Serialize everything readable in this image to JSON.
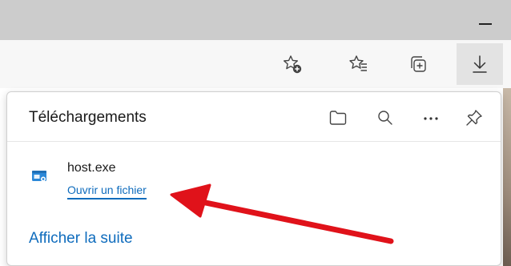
{
  "window": {
    "minimize_icon": "minimize-icon"
  },
  "toolbar": {
    "buttons": [
      {
        "name": "add-favorite",
        "icon": "star-plus-icon"
      },
      {
        "name": "favorites",
        "icon": "star-list-icon"
      },
      {
        "name": "collections",
        "icon": "collections-icon"
      },
      {
        "name": "downloads",
        "icon": "download-icon",
        "active": true
      }
    ]
  },
  "downloads_panel": {
    "title": "Téléchargements",
    "actions": [
      {
        "name": "open-folder",
        "icon": "folder-icon"
      },
      {
        "name": "search",
        "icon": "search-icon"
      },
      {
        "name": "more",
        "icon": "more-icon"
      },
      {
        "name": "pin",
        "icon": "pin-icon"
      }
    ],
    "items": [
      {
        "file_name": "host.exe",
        "action_label": "Ouvrir un fichier",
        "icon": "exe-file-icon"
      }
    ],
    "show_more_label": "Afficher la suite"
  },
  "colors": {
    "link": "#0f6cbd",
    "annotation_arrow": "#e0121a",
    "titlebar": "#cccccc",
    "toolbar": "#f7f7f7",
    "active_button": "#e3e3e3"
  }
}
